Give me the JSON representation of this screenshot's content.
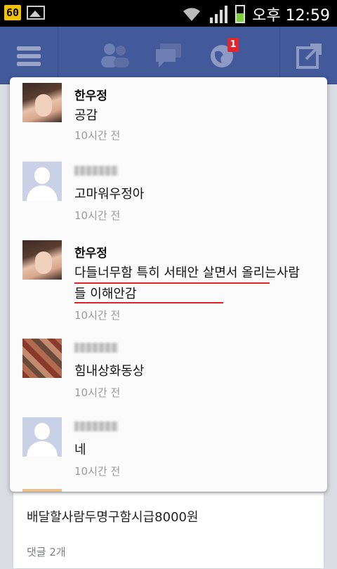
{
  "status_bar": {
    "left_badge": "60",
    "time": "오후 12:59",
    "icons": [
      "gallery-icon",
      "wifi-icon",
      "signal-icon",
      "battery-icon"
    ]
  },
  "nav": {
    "notification_count": "1",
    "icons": [
      "menu-icon",
      "friends-icon",
      "messages-icon",
      "globe-icon",
      "share-icon"
    ]
  },
  "notifications": [
    {
      "name": "한우정",
      "text": "공감",
      "time": "10시간 전",
      "avatar": "photo"
    },
    {
      "name": "",
      "text": "고마워우정아",
      "time": "10시간 전",
      "avatar": "default"
    },
    {
      "name": "한우정",
      "text": "다들너무함  특히 서태안 살면서 올리는사람들  이해안감",
      "time": "10시간 전",
      "avatar": "photo"
    },
    {
      "name": "",
      "text": "힘내상화동상",
      "time": "10시간 전",
      "avatar": "blurred"
    },
    {
      "name": "",
      "text": "네",
      "time": "10시간 전",
      "avatar": "default"
    }
  ],
  "background_post": {
    "text": "배달할사람두명구함시급8000원",
    "comments": "댓글 2개"
  },
  "colors": {
    "nav_bg": "#42599a",
    "badge_red": "#e0262c",
    "underline_red": "#d8262b"
  }
}
